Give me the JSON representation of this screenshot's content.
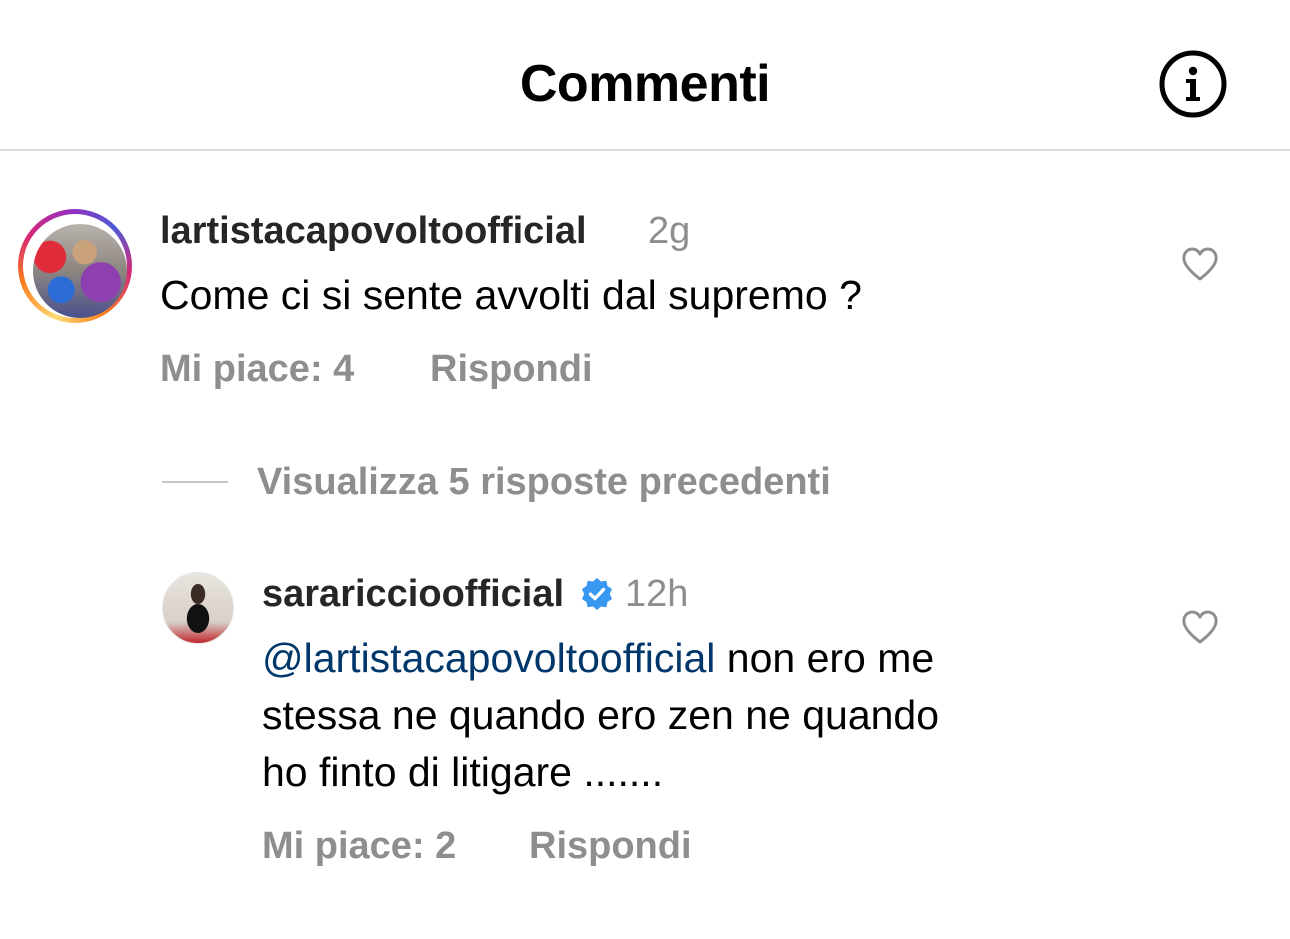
{
  "header": {
    "title": "Commenti",
    "info_icon": "info-icon"
  },
  "comments": [
    {
      "username": "lartistacapovoltoofficial",
      "timestamp": "2g",
      "text": "Come ci si sente avvolti dal supremo ?",
      "likes_label": "Mi piace: 4",
      "reply_label": "Rispondi",
      "avatar_ring": true,
      "verified": false
    }
  ],
  "thread": {
    "view_replies_label": "Visualizza 5 risposte precedenti"
  },
  "replies": [
    {
      "username": "sarariccioofficial",
      "timestamp": "12h",
      "mention": "@lartistacapovoltoofficial",
      "text_line1_rest": " non ero me",
      "text_line2": "stessa ne quando ero zen ne quando",
      "text_line3": "ho finto di litigare .......",
      "likes_label": "Mi piace: 2",
      "reply_label": "Rispondi",
      "verified": true
    }
  ],
  "colors": {
    "username": "#262626",
    "secondary": "#8e8e8e",
    "mention": "#00376b",
    "divider": "#dbdbdb",
    "verified": "#3897f0"
  }
}
